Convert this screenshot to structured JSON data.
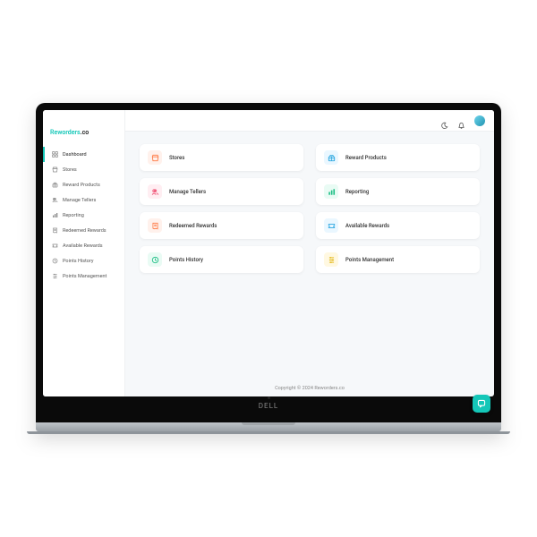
{
  "brand": {
    "part1": "Reworders",
    "part1_color": "#14c7b8",
    "part2": ".co",
    "part2_color": "#222"
  },
  "sidebar": {
    "active_index": 0,
    "items": [
      {
        "label": "Dashboard",
        "icon": "grid-icon"
      },
      {
        "label": "Stores",
        "icon": "store-icon"
      },
      {
        "label": "Reward Products",
        "icon": "gift-icon"
      },
      {
        "label": "Manage Tellers",
        "icon": "users-icon"
      },
      {
        "label": "Reporting",
        "icon": "chart-icon"
      },
      {
        "label": "Redeemed Rewards",
        "icon": "receipt-icon"
      },
      {
        "label": "Available Rewards",
        "icon": "ticket-icon"
      },
      {
        "label": "Points History",
        "icon": "history-icon"
      },
      {
        "label": "Points Management",
        "icon": "sliders-icon"
      }
    ]
  },
  "cards": [
    {
      "label": "Stores",
      "icon": "store-icon",
      "bg": "#fff1ec",
      "fg": "#ff7a45"
    },
    {
      "label": "Reward Products",
      "icon": "gift-icon",
      "bg": "#eaf7ff",
      "fg": "#2aa7e0"
    },
    {
      "label": "Manage Tellers",
      "icon": "users-icon",
      "bg": "#ffeef2",
      "fg": "#f05577"
    },
    {
      "label": "Reporting",
      "icon": "chart-icon",
      "bg": "#e9fbf4",
      "fg": "#1fbf86"
    },
    {
      "label": "Redeemed Rewards",
      "icon": "receipt-icon",
      "bg": "#fff1ec",
      "fg": "#ff7a45"
    },
    {
      "label": "Available Rewards",
      "icon": "ticket-icon",
      "bg": "#eaf7ff",
      "fg": "#2aa7e0"
    },
    {
      "label": "Points History",
      "icon": "history-icon",
      "bg": "#e9fbf4",
      "fg": "#1fbf86"
    },
    {
      "label": "Points Management",
      "icon": "sliders-icon",
      "bg": "#fff8e1",
      "fg": "#e0b000"
    }
  ],
  "footer": "Copyright © 2024 Reworders.co",
  "device_brand": "DELL"
}
